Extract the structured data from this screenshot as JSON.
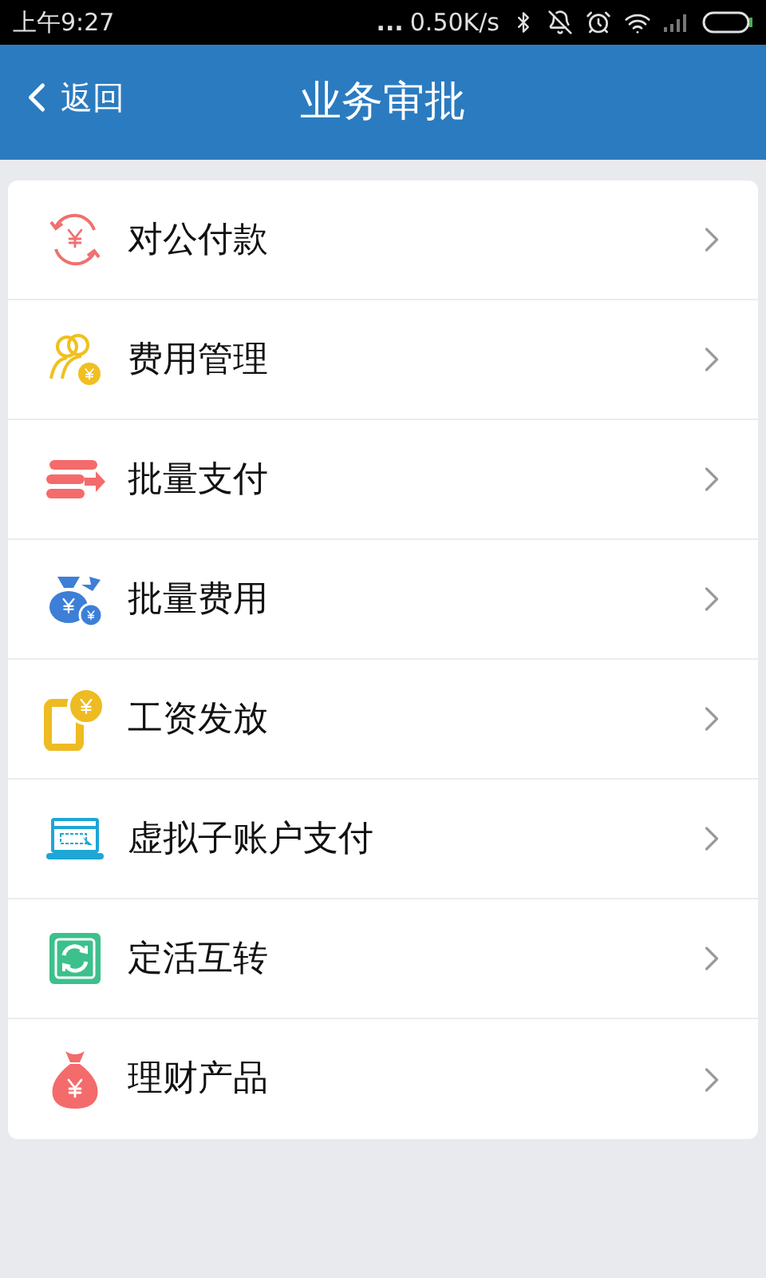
{
  "status_bar": {
    "time": "上午9:27",
    "dots": "...",
    "speed": "0.50K/s"
  },
  "header": {
    "back": "返回",
    "title": "业务审批"
  },
  "items": [
    {
      "label": "对公付款"
    },
    {
      "label": "费用管理"
    },
    {
      "label": "批量支付"
    },
    {
      "label": "批量费用"
    },
    {
      "label": "工资发放"
    },
    {
      "label": "虚拟子账户支付"
    },
    {
      "label": "定活互转"
    },
    {
      "label": "理财产品"
    }
  ]
}
